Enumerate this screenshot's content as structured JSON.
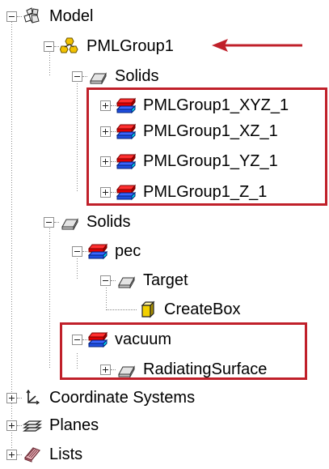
{
  "tree": {
    "model": {
      "label": "Model",
      "icon": "model-icon"
    },
    "pml_group": {
      "label": "PMLGroup1",
      "icon": "group-icon"
    },
    "pml_solids": {
      "label": "Solids",
      "icon": "solids-folder-icon"
    },
    "pml_children": [
      {
        "label": "PMLGroup1_XYZ_1",
        "icon": "solid-part-icon"
      },
      {
        "label": "PMLGroup1_XZ_1",
        "icon": "solid-part-icon"
      },
      {
        "label": "PMLGroup1_YZ_1",
        "icon": "solid-part-icon"
      },
      {
        "label": "PMLGroup1_Z_1",
        "icon": "solid-part-icon"
      }
    ],
    "solids": {
      "label": "Solids",
      "icon": "solids-folder-icon"
    },
    "pec": {
      "label": "pec",
      "icon": "solid-part-icon"
    },
    "target": {
      "label": "Target",
      "icon": "solids-folder-icon"
    },
    "create_box": {
      "label": "CreateBox",
      "icon": "box-icon"
    },
    "vacuum": {
      "label": "vacuum",
      "icon": "solid-part-icon"
    },
    "radiating_surface": {
      "label": "RadiatingSurface",
      "icon": "solids-folder-icon"
    },
    "coordinate_systems": {
      "label": "Coordinate Systems",
      "icon": "axes-icon"
    },
    "planes": {
      "label": "Planes",
      "icon": "planes-icon"
    },
    "lists": {
      "label": "Lists",
      "icon": "lists-icon"
    }
  },
  "annotations": {
    "highlight_color": "#c0202a",
    "arrow_color": "#c0202a"
  }
}
